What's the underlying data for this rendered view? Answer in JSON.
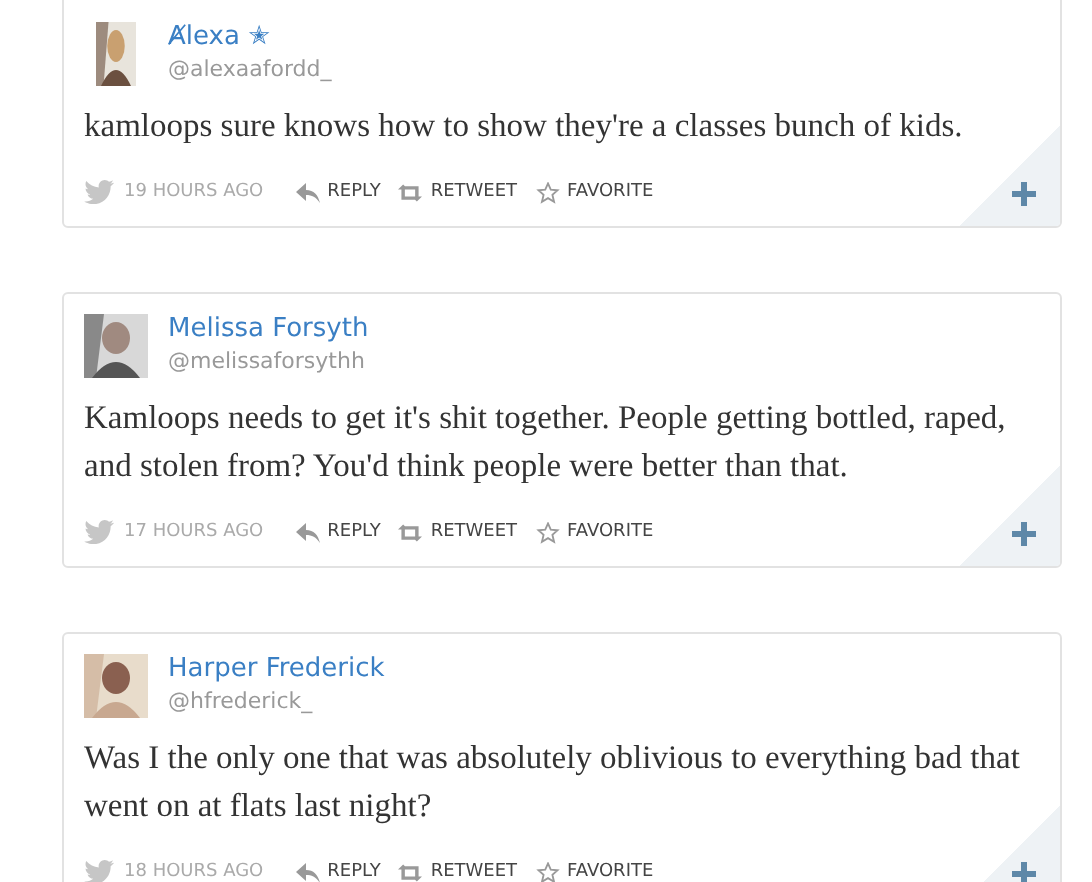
{
  "tweets": [
    {
      "name": "Ⱥlexa ✭",
      "handle": "@alexaafordd_",
      "text": "kamloops sure knows how to show they're a classes bunch of kids.",
      "time": "19 HOURS AGO",
      "actions": [
        "REPLY",
        "RETWEET",
        "FAVORITE"
      ]
    },
    {
      "name": "Melissa Forsyth",
      "handle": "@melissaforsythh",
      "text": "Kamloops needs to get it's shit together. People getting bottled, raped, and stolen from? You'd think people were better than that.",
      "time": "17 HOURS AGO",
      "actions": [
        "REPLY",
        "RETWEET",
        "FAVORITE"
      ]
    },
    {
      "name": "Harper Frederick",
      "handle": "@hfrederick_",
      "text": "Was I the only one that was absolutely oblivious to everything bad that went on at flats last night?",
      "time": "18 HOURS AGO",
      "actions": [
        "REPLY",
        "RETWEET",
        "FAVORITE"
      ]
    }
  ]
}
